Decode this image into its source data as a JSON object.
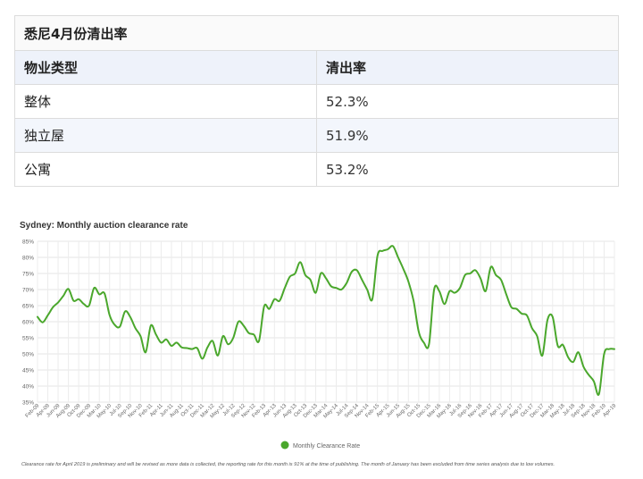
{
  "table": {
    "title": "悉尼4月份清出率",
    "headers": [
      "物业类型",
      "清出率"
    ],
    "rows": [
      {
        "type": "整体",
        "rate": "52.3%"
      },
      {
        "type": "独立屋",
        "rate": "51.9%"
      },
      {
        "type": "公寓",
        "rate": "53.2%"
      }
    ]
  },
  "chart_data": {
    "type": "line",
    "title": "Sydney: Monthly auction clearance rate",
    "legend": "Monthly Clearance Rate",
    "legend_position": "bottom-center",
    "footnote": "Clearance rate for April 2019 is preliminary and will be revised as more data is collected, the reporting rate for this month is 91% at the time of publishing. The month of January has been excluded from time series analysis due to low volumes.",
    "ylim": [
      35,
      85
    ],
    "yticks": [
      "35%",
      "40%",
      "45%",
      "50%",
      "55%",
      "60%",
      "65%",
      "70%",
      "75%",
      "80%",
      "85%"
    ],
    "grid": true,
    "color": "#4aa72c",
    "x": [
      "Feb-09",
      "Mar-09",
      "Apr-09",
      "May-09",
      "Jun-09",
      "Jul-09",
      "Aug-09",
      "Sep-09",
      "Oct-09",
      "Nov-09",
      "Dec-09",
      "Feb-10",
      "Mar-10",
      "Apr-10",
      "May-10",
      "Jun-10",
      "Jul-10",
      "Aug-10",
      "Sep-10",
      "Oct-10",
      "Nov-10",
      "Dec-10",
      "Feb-11",
      "Mar-11",
      "Apr-11",
      "May-11",
      "Jun-11",
      "Jul-11",
      "Aug-11",
      "Sep-11",
      "Oct-11",
      "Nov-11",
      "Dec-11",
      "Feb-12",
      "Mar-12",
      "Apr-12",
      "May-12",
      "Jun-12",
      "Jul-12",
      "Aug-12",
      "Sep-12",
      "Oct-12",
      "Nov-12",
      "Dec-12",
      "Feb-13",
      "Mar-13",
      "Apr-13",
      "May-13",
      "Jun-13",
      "Jul-13",
      "Aug-13",
      "Sep-13",
      "Oct-13",
      "Nov-13",
      "Dec-13",
      "Feb-14",
      "Mar-14",
      "Apr-14",
      "May-14",
      "Jun-14",
      "Jul-14",
      "Aug-14",
      "Sep-14",
      "Oct-14",
      "Nov-14",
      "Dec-14",
      "Feb-15",
      "Mar-15",
      "Apr-15",
      "May-15",
      "Jun-15",
      "Jul-15",
      "Aug-15",
      "Sep-15",
      "Oct-15",
      "Nov-15",
      "Dec-15",
      "Feb-16",
      "Mar-16",
      "Apr-16",
      "May-16",
      "Jun-16",
      "Jul-16",
      "Aug-16",
      "Sep-16",
      "Oct-16",
      "Nov-16",
      "Dec-16",
      "Feb-17",
      "Mar-17",
      "Apr-17",
      "May-17",
      "Jun-17",
      "Jul-17",
      "Aug-17",
      "Sep-17",
      "Oct-17",
      "Nov-17",
      "Dec-17",
      "Feb-18",
      "Mar-18",
      "Apr-18",
      "May-18",
      "Jun-18",
      "Jul-18",
      "Aug-18",
      "Sep-18",
      "Oct-18",
      "Nov-18",
      "Dec-18",
      "Feb-19",
      "Mar-19",
      "Apr-19"
    ],
    "x_tick_labels": [
      "Feb-09",
      "Apr-09",
      "Jun-09",
      "Aug-09",
      "Oct-09",
      "Dec-09",
      "Mar-10",
      "May-10",
      "Jul-10",
      "Sep-10",
      "Nov-10",
      "Feb-11",
      "Apr-11",
      "Jun-11",
      "Aug-11",
      "Oct-11",
      "Dec-11",
      "Mar-12",
      "May-12",
      "Jul-12",
      "Sep-12",
      "Nov-12",
      "Feb-13",
      "Apr-13",
      "Jun-13",
      "Aug-13",
      "Oct-13",
      "Dec-13",
      "Mar-14",
      "May-14",
      "Jul-14",
      "Sep-14",
      "Nov-14",
      "Feb-15",
      "Apr-15",
      "Jun-15",
      "Aug-15",
      "Oct-15",
      "Dec-15",
      "Mar-16",
      "May-16",
      "Jul-16",
      "Sep-16",
      "Nov-16",
      "Feb-17",
      "Apr-17",
      "Jun-17",
      "Aug-17",
      "Oct-17",
      "Dec-17",
      "Mar-18",
      "May-18",
      "Jul-18",
      "Sep-18",
      "Nov-18",
      "Feb-19",
      "Apr-19"
    ],
    "values": [
      61.5,
      59.8,
      62.0,
      64.5,
      66.0,
      68.0,
      70.2,
      66.5,
      67.0,
      65.5,
      65.0,
      70.5,
      68.5,
      68.8,
      62.0,
      59.0,
      58.5,
      63.2,
      61.5,
      58.0,
      55.5,
      50.5,
      58.8,
      56.0,
      53.5,
      54.5,
      52.5,
      53.5,
      52.0,
      51.8,
      51.5,
      51.8,
      48.5,
      52.0,
      54.0,
      49.5,
      55.5,
      53.0,
      55.0,
      60.0,
      58.8,
      56.5,
      56.0,
      54.0,
      64.8,
      64.0,
      67.0,
      66.5,
      70.5,
      74.0,
      75.0,
      78.5,
      74.5,
      73.0,
      69.0,
      75.0,
      73.5,
      71.0,
      70.5,
      70.0,
      72.0,
      75.5,
      76.0,
      73.0,
      70.0,
      67.0,
      80.5,
      82.0,
      82.5,
      83.5,
      80.0,
      76.5,
      72.5,
      66.5,
      57.0,
      53.5,
      53.0,
      70.0,
      69.5,
      65.5,
      69.5,
      69.0,
      70.5,
      74.5,
      75.0,
      76.0,
      73.5,
      69.5,
      77.0,
      74.5,
      73.0,
      68.5,
      64.5,
      64.0,
      62.5,
      62.0,
      58.0,
      55.5,
      49.5,
      60.5,
      61.5,
      52.5,
      52.8,
      49.0,
      47.5,
      50.5,
      46.0,
      43.5,
      41.5,
      37.5,
      50.0,
      51.5,
      51.5
    ]
  }
}
